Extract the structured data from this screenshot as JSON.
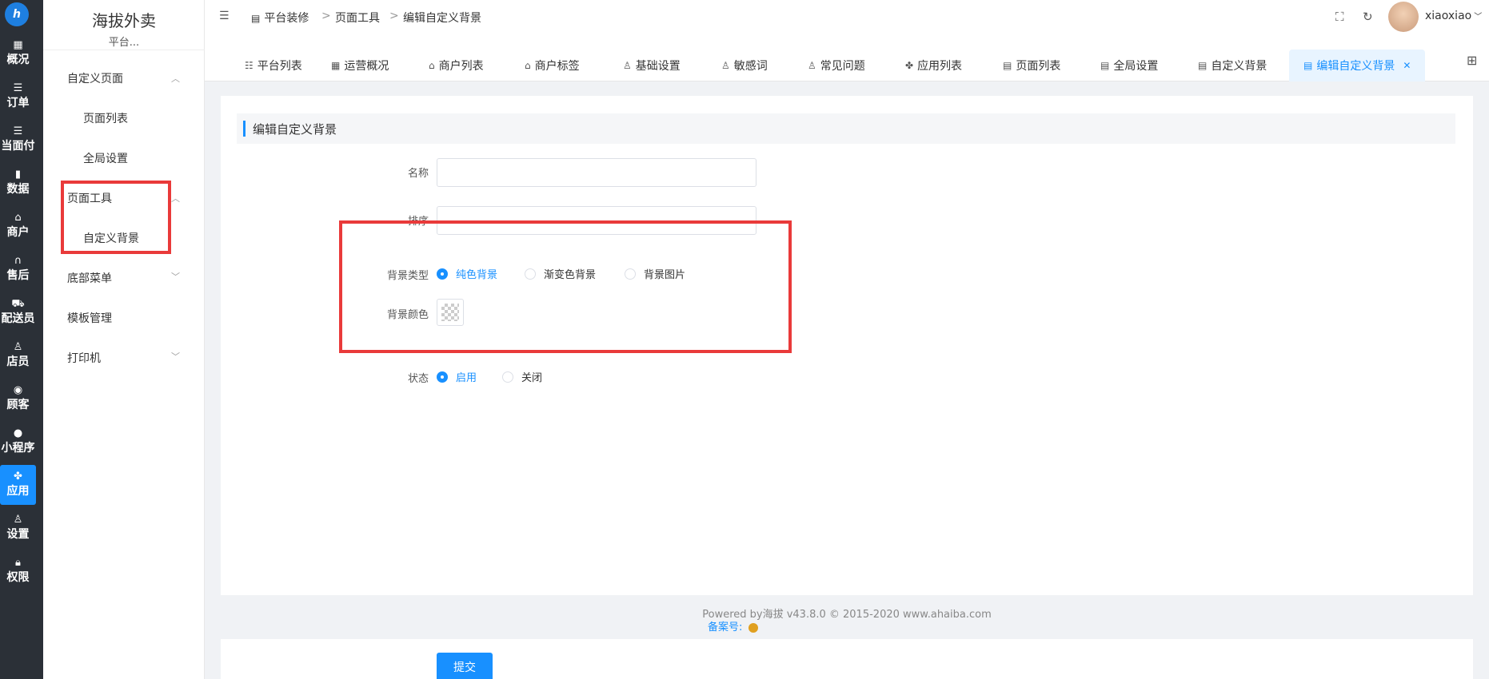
{
  "rail": {
    "logo": "h",
    "items": [
      {
        "label": "概况",
        "icon": "grid-icon"
      },
      {
        "label": "订单",
        "icon": "list-icon"
      },
      {
        "label": "当面付",
        "icon": "list-icon"
      },
      {
        "label": "数据",
        "icon": "bar-chart-icon"
      },
      {
        "label": "商户",
        "icon": "store-icon"
      },
      {
        "label": "售后",
        "icon": "headset-icon"
      },
      {
        "label": "配送员",
        "icon": "delivery-icon"
      },
      {
        "label": "店员",
        "icon": "user-icon"
      },
      {
        "label": "顾客",
        "icon": "customer-icon"
      },
      {
        "label": "小程序",
        "icon": "wechat-icon"
      },
      {
        "label": "应用",
        "icon": "apps-icon"
      },
      {
        "label": "设置",
        "icon": "settings-icon"
      },
      {
        "label": "权限",
        "icon": "lock-icon"
      }
    ],
    "active_index": 10
  },
  "sidebar": {
    "brand": "海拔外卖",
    "subtitle": "平台...",
    "menu": [
      {
        "label": "自定义页面",
        "expanded": true
      },
      {
        "label": "页面列表",
        "sub": true
      },
      {
        "label": "全局设置",
        "sub": true
      },
      {
        "label": "页面工具",
        "expanded": true
      },
      {
        "label": "自定义背景",
        "sub": true
      },
      {
        "label": "底部菜单",
        "expanded": false
      },
      {
        "label": "模板管理"
      },
      {
        "label": "打印机",
        "expanded": false
      }
    ]
  },
  "header": {
    "breadcrumb": [
      "平台装修",
      "页面工具",
      "编辑自定义背景"
    ],
    "username": "xiaoxiao"
  },
  "tabs": [
    {
      "label": "平台列表",
      "icon": "list-icon"
    },
    {
      "label": "运营概况",
      "icon": "grid-icon"
    },
    {
      "label": "商户列表",
      "icon": "store-icon"
    },
    {
      "label": "商户标签",
      "icon": "store-icon"
    },
    {
      "label": "基础设置",
      "icon": "user-icon"
    },
    {
      "label": "敏感词",
      "icon": "user-icon"
    },
    {
      "label": "常见问题",
      "icon": "user-icon"
    },
    {
      "label": "应用列表",
      "icon": "apps-icon"
    },
    {
      "label": "页面列表",
      "icon": "page-icon"
    },
    {
      "label": "全局设置",
      "icon": "page-icon"
    },
    {
      "label": "自定义背景",
      "icon": "page-icon"
    },
    {
      "label": "编辑自定义背景",
      "icon": "page-icon",
      "active": true
    }
  ],
  "form": {
    "section_title": "编辑自定义背景",
    "name_label": "名称",
    "name_value": "",
    "sort_label": "排序",
    "sort_value": "",
    "bg_type_label": "背景类型",
    "bg_type_options": [
      "纯色背景",
      "渐变色背景",
      "背景图片"
    ],
    "bg_type_selected": "纯色背景",
    "bg_color_label": "背景颜色",
    "status_label": "状态",
    "status_options": [
      "启用",
      "关闭"
    ],
    "status_selected": "启用",
    "submit_label": "提交"
  },
  "footer": {
    "powered": "Powered by海拔 v43.8.0 © 2015-2020 www.ahaiba.com",
    "beian": "备案号:"
  },
  "colors": {
    "accent": "#1890ff",
    "rail_bg": "#2b3037",
    "highlight": "#e93a3a"
  }
}
